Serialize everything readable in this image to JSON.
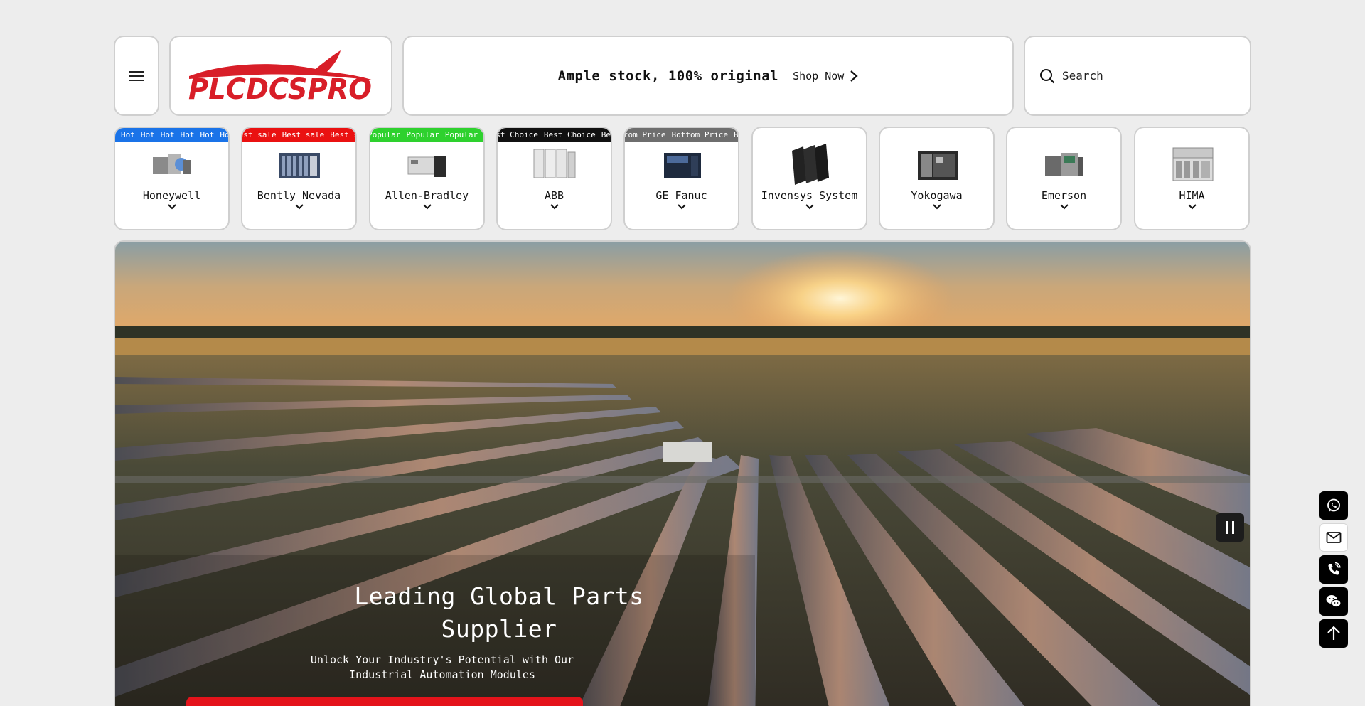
{
  "header": {
    "logo_text": "PLCDCSPRO",
    "promo_text": "Ample stock, 100% original",
    "shop_now_label": "Shop Now",
    "search_placeholder": "Search"
  },
  "brands": [
    {
      "name": "Honeywell",
      "ribbon": "Hot",
      "ribbon_color": "#1a73e8"
    },
    {
      "name": "Bently Nevada",
      "ribbon": "Best sale",
      "ribbon_color": "#ea1111"
    },
    {
      "name": "Allen-Bradley",
      "ribbon": "Popular",
      "ribbon_color": "#2ed12e"
    },
    {
      "name": "ABB",
      "ribbon": "Best Choice",
      "ribbon_color": "#111111"
    },
    {
      "name": "GE Fanuc",
      "ribbon": "Bottom Price",
      "ribbon_color": "#6e6e6e"
    },
    {
      "name": "Invensys System",
      "ribbon": "",
      "ribbon_color": ""
    },
    {
      "name": "Yokogawa",
      "ribbon": "",
      "ribbon_color": ""
    },
    {
      "name": "Emerson",
      "ribbon": "",
      "ribbon_color": ""
    },
    {
      "name": "HIMA",
      "ribbon": "",
      "ribbon_color": ""
    }
  ],
  "hero": {
    "title": "Leading Global Parts Supplier",
    "subtitle": "Unlock Your Industry's Potential with Our Industrial Automation Modules"
  },
  "floating_contacts": [
    "whatsapp-icon",
    "email-icon",
    "phone-icon",
    "wechat-icon",
    "arrow-up-icon"
  ],
  "colors": {
    "accent": "#e4131b",
    "page_bg": "#ededed"
  }
}
